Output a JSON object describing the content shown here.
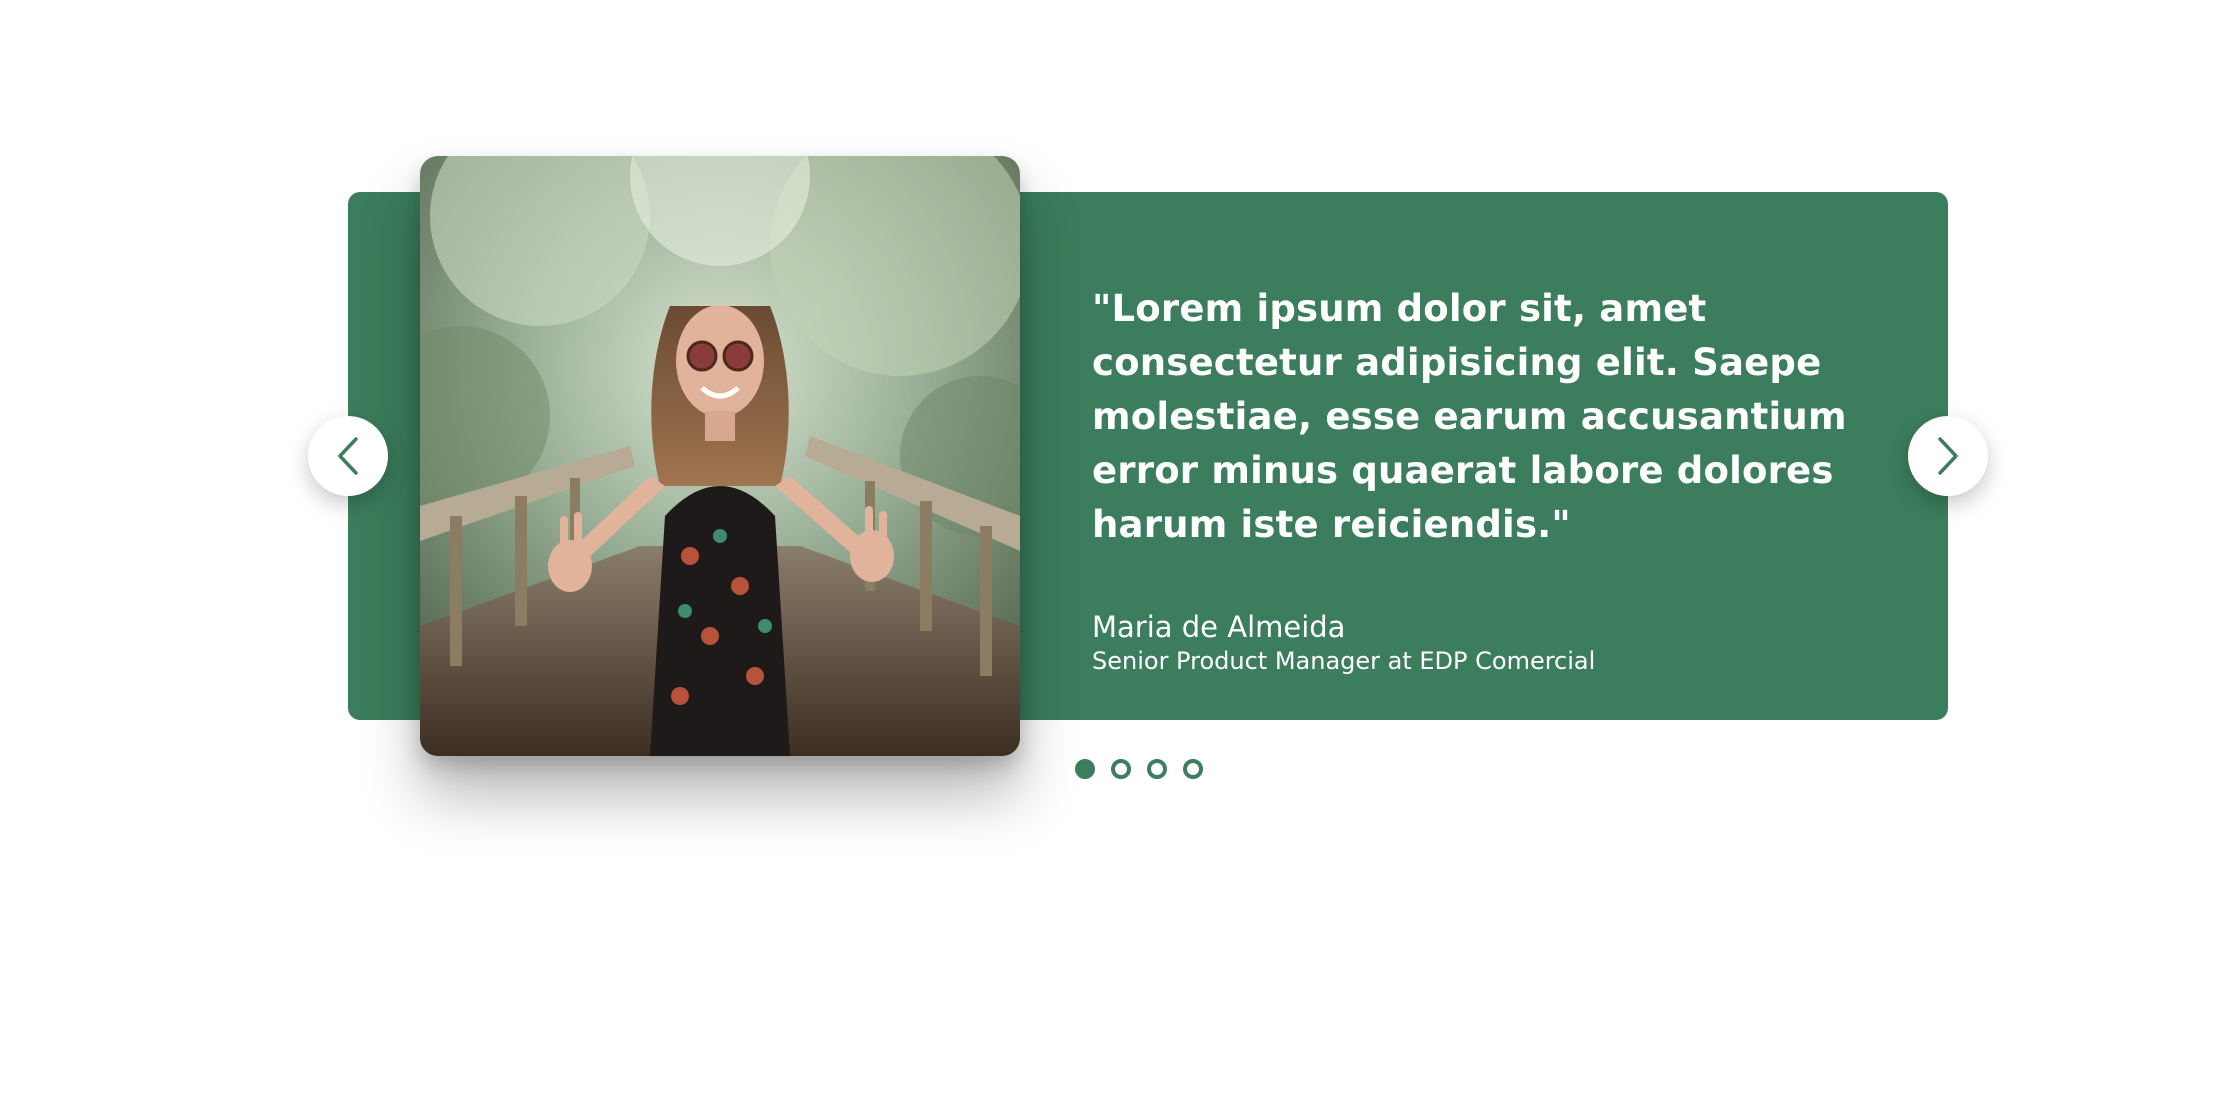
{
  "testimonial": {
    "quote": "\"Lorem ipsum dolor sit, amet consectetur adipisicing elit. Saepe molestiae, esse earum accusantium error minus quaerat labore dolores harum iste reiciendis.\"",
    "author_name": "Maria de Almeida",
    "author_role": "Senior Product Manager at EDP Comercial"
  },
  "navigation": {
    "prev_icon": "chevron-left-icon",
    "next_icon": "chevron-right-icon"
  },
  "pagination": {
    "total": 4,
    "active_index": 0
  },
  "colors": {
    "accent": "#3b7d5c",
    "text_on_accent": "#ffffff",
    "background": "#ffffff"
  }
}
